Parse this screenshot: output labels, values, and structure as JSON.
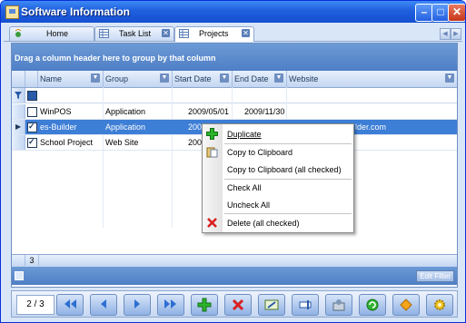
{
  "window": {
    "title": "Software Information"
  },
  "tabs": [
    {
      "label": "Home",
      "icon": "home-icon"
    },
    {
      "label": "Task List",
      "icon": "grid-icon"
    },
    {
      "label": "Projects",
      "icon": "grid-icon",
      "active": true
    }
  ],
  "grid": {
    "group_panel_text": "Drag a column header here to group by that column",
    "columns": [
      "Name",
      "Group",
      "Start Date",
      "End Date",
      "Website"
    ],
    "rows": [
      {
        "checked": false,
        "name": "WinPOS",
        "group": "Application",
        "start": "2009/05/01",
        "end": "2009/11/30",
        "website": "",
        "selected": false
      },
      {
        "checked": true,
        "name": "es-Builder",
        "group": "Application",
        "start": "200",
        "end": "",
        "website": "lder.com",
        "selected": true
      },
      {
        "checked": true,
        "name": "School Project",
        "group": "Web Site",
        "start": "200",
        "end": "",
        "website": "",
        "selected": false
      }
    ],
    "footer_count": "3",
    "edit_filter_label": "Edit Filter"
  },
  "context_menu": {
    "items": [
      {
        "label": "Duplicate",
        "icon": "plus-icon"
      },
      {
        "label": "Copy to Clipboard",
        "icon": "clipboard-icon"
      },
      {
        "label": "Copy to Clipboard (all checked)",
        "icon": ""
      },
      {
        "label": "Check All",
        "icon": ""
      },
      {
        "label": "Uncheck All",
        "icon": ""
      },
      {
        "label": "Delete  (all checked)",
        "icon": "delete-icon"
      }
    ]
  },
  "navigator": {
    "page": "2 / 3"
  }
}
